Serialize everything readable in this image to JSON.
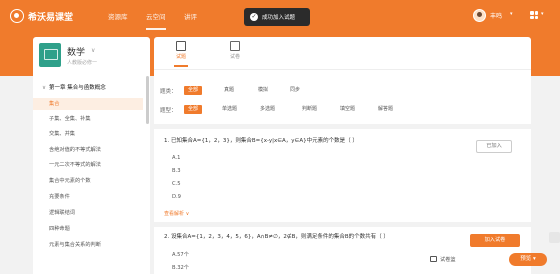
{
  "header": {
    "logo_text": "希沃易课堂",
    "nav": [
      "资源库",
      "云空间",
      "讲评"
    ],
    "user_name": "丰鸣",
    "colors": {
      "brand": "#f07b2c",
      "toast_bg": "#2b2b2b"
    }
  },
  "toast": {
    "text": "成功加入试题"
  },
  "subject": {
    "name": "数学",
    "subtitle": "人教版必修一"
  },
  "tree": {
    "chapter": "第一章 集合与函数概念",
    "items": [
      "集合",
      "子集、全集、补集",
      "交集、并集",
      "含绝对值的不等式解法",
      "一元二次不等式的解法",
      "集合中元素的个数",
      "充要条件",
      "逻辑联结词",
      "四种命题",
      "元素与集合关系的判断"
    ]
  },
  "tabs": [
    "试题",
    "试卷"
  ],
  "filters": {
    "row1_label": "题类：",
    "row1": [
      "全部",
      "真题",
      "模拟",
      "同步"
    ],
    "row2_label": "题型：",
    "row2": [
      "全部",
      "单选题",
      "多选题",
      "判断题",
      "填空题",
      "解答题"
    ]
  },
  "questions": [
    {
      "title": "1. 已知集合A={1，2，3}，则集合B={x-y|x∈A，y∈A}中元素的个数是（     ）",
      "options": [
        "A.1",
        "B.3",
        "C.5",
        "D.9"
      ],
      "more": "查看解析",
      "state": "已加入"
    },
    {
      "title": "2. 设集合A={1，2，3，4，5，6}，A∩B≠∅，2∉B，则满足条件的集合B的个数共有（     ）",
      "options": [
        "A.57个",
        "B.32个"
      ],
      "state": "加入试卷"
    }
  ],
  "footer": {
    "basket": "试卷篮",
    "preview": "预览"
  }
}
